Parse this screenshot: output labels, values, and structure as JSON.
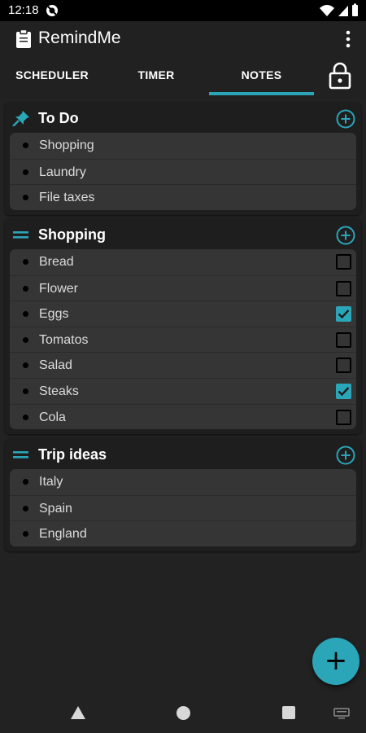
{
  "status_bar": {
    "time": "12:18"
  },
  "app": {
    "title": "RemindMe"
  },
  "tabs": [
    {
      "label": "SCHEDULER"
    },
    {
      "label": "TIMER"
    },
    {
      "label": "NOTES"
    }
  ],
  "active_tab": "NOTES",
  "colors": {
    "accent": "#2ba5b8",
    "background": "#222222",
    "card": "#1e1e1e",
    "row": "#353535"
  },
  "icons": {
    "app": "clipboard-icon",
    "overflow": "more-vert-icon",
    "lock": "lock-icon",
    "pinned_note": "pin-icon",
    "note_drag": "drag-handle-icon",
    "add": "add-circle-icon",
    "fab": "plus-icon"
  },
  "notes": [
    {
      "title": "To Do",
      "items": [
        {
          "text": "Shopping"
        },
        {
          "text": "Laundry"
        },
        {
          "text": "File taxes"
        }
      ]
    },
    {
      "title": "Shopping",
      "items": [
        {
          "text": "Bread",
          "checked": false
        },
        {
          "text": "Flower",
          "checked": false
        },
        {
          "text": "Eggs",
          "checked": true
        },
        {
          "text": "Tomatos",
          "checked": false
        },
        {
          "text": "Salad",
          "checked": false
        },
        {
          "text": "Steaks",
          "checked": true
        },
        {
          "text": "Cola",
          "checked": false
        }
      ]
    },
    {
      "title": "Trip ideas",
      "items": [
        {
          "text": "Italy"
        },
        {
          "text": "Spain"
        },
        {
          "text": "England"
        }
      ]
    }
  ],
  "fab": {
    "label": "+"
  }
}
